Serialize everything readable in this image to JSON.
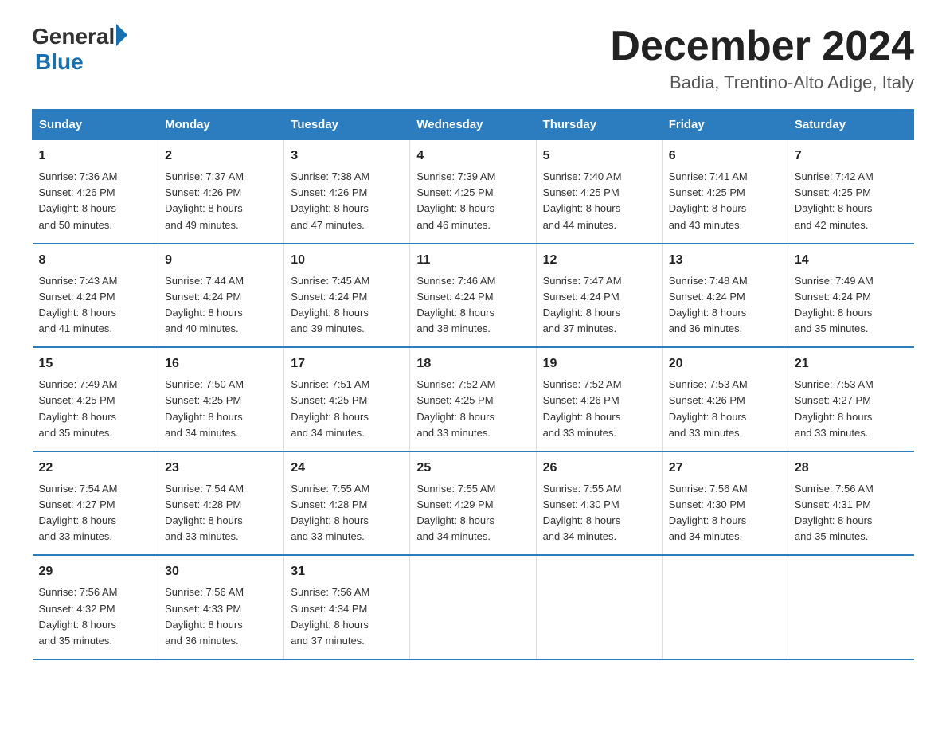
{
  "header": {
    "logo_general": "General",
    "logo_blue": "Blue",
    "month_title": "December 2024",
    "location": "Badia, Trentino-Alto Adige, Italy"
  },
  "days_of_week": [
    "Sunday",
    "Monday",
    "Tuesday",
    "Wednesday",
    "Thursday",
    "Friday",
    "Saturday"
  ],
  "weeks": [
    [
      {
        "day": "1",
        "sunrise": "7:36 AM",
        "sunset": "4:26 PM",
        "daylight": "8 hours and 50 minutes."
      },
      {
        "day": "2",
        "sunrise": "7:37 AM",
        "sunset": "4:26 PM",
        "daylight": "8 hours and 49 minutes."
      },
      {
        "day": "3",
        "sunrise": "7:38 AM",
        "sunset": "4:26 PM",
        "daylight": "8 hours and 47 minutes."
      },
      {
        "day": "4",
        "sunrise": "7:39 AM",
        "sunset": "4:25 PM",
        "daylight": "8 hours and 46 minutes."
      },
      {
        "day": "5",
        "sunrise": "7:40 AM",
        "sunset": "4:25 PM",
        "daylight": "8 hours and 44 minutes."
      },
      {
        "day": "6",
        "sunrise": "7:41 AM",
        "sunset": "4:25 PM",
        "daylight": "8 hours and 43 minutes."
      },
      {
        "day": "7",
        "sunrise": "7:42 AM",
        "sunset": "4:25 PM",
        "daylight": "8 hours and 42 minutes."
      }
    ],
    [
      {
        "day": "8",
        "sunrise": "7:43 AM",
        "sunset": "4:24 PM",
        "daylight": "8 hours and 41 minutes."
      },
      {
        "day": "9",
        "sunrise": "7:44 AM",
        "sunset": "4:24 PM",
        "daylight": "8 hours and 40 minutes."
      },
      {
        "day": "10",
        "sunrise": "7:45 AM",
        "sunset": "4:24 PM",
        "daylight": "8 hours and 39 minutes."
      },
      {
        "day": "11",
        "sunrise": "7:46 AM",
        "sunset": "4:24 PM",
        "daylight": "8 hours and 38 minutes."
      },
      {
        "day": "12",
        "sunrise": "7:47 AM",
        "sunset": "4:24 PM",
        "daylight": "8 hours and 37 minutes."
      },
      {
        "day": "13",
        "sunrise": "7:48 AM",
        "sunset": "4:24 PM",
        "daylight": "8 hours and 36 minutes."
      },
      {
        "day": "14",
        "sunrise": "7:49 AM",
        "sunset": "4:24 PM",
        "daylight": "8 hours and 35 minutes."
      }
    ],
    [
      {
        "day": "15",
        "sunrise": "7:49 AM",
        "sunset": "4:25 PM",
        "daylight": "8 hours and 35 minutes."
      },
      {
        "day": "16",
        "sunrise": "7:50 AM",
        "sunset": "4:25 PM",
        "daylight": "8 hours and 34 minutes."
      },
      {
        "day": "17",
        "sunrise": "7:51 AM",
        "sunset": "4:25 PM",
        "daylight": "8 hours and 34 minutes."
      },
      {
        "day": "18",
        "sunrise": "7:52 AM",
        "sunset": "4:25 PM",
        "daylight": "8 hours and 33 minutes."
      },
      {
        "day": "19",
        "sunrise": "7:52 AM",
        "sunset": "4:26 PM",
        "daylight": "8 hours and 33 minutes."
      },
      {
        "day": "20",
        "sunrise": "7:53 AM",
        "sunset": "4:26 PM",
        "daylight": "8 hours and 33 minutes."
      },
      {
        "day": "21",
        "sunrise": "7:53 AM",
        "sunset": "4:27 PM",
        "daylight": "8 hours and 33 minutes."
      }
    ],
    [
      {
        "day": "22",
        "sunrise": "7:54 AM",
        "sunset": "4:27 PM",
        "daylight": "8 hours and 33 minutes."
      },
      {
        "day": "23",
        "sunrise": "7:54 AM",
        "sunset": "4:28 PM",
        "daylight": "8 hours and 33 minutes."
      },
      {
        "day": "24",
        "sunrise": "7:55 AM",
        "sunset": "4:28 PM",
        "daylight": "8 hours and 33 minutes."
      },
      {
        "day": "25",
        "sunrise": "7:55 AM",
        "sunset": "4:29 PM",
        "daylight": "8 hours and 34 minutes."
      },
      {
        "day": "26",
        "sunrise": "7:55 AM",
        "sunset": "4:30 PM",
        "daylight": "8 hours and 34 minutes."
      },
      {
        "day": "27",
        "sunrise": "7:56 AM",
        "sunset": "4:30 PM",
        "daylight": "8 hours and 34 minutes."
      },
      {
        "day": "28",
        "sunrise": "7:56 AM",
        "sunset": "4:31 PM",
        "daylight": "8 hours and 35 minutes."
      }
    ],
    [
      {
        "day": "29",
        "sunrise": "7:56 AM",
        "sunset": "4:32 PM",
        "daylight": "8 hours and 35 minutes."
      },
      {
        "day": "30",
        "sunrise": "7:56 AM",
        "sunset": "4:33 PM",
        "daylight": "8 hours and 36 minutes."
      },
      {
        "day": "31",
        "sunrise": "7:56 AM",
        "sunset": "4:34 PM",
        "daylight": "8 hours and 37 minutes."
      },
      null,
      null,
      null,
      null
    ]
  ],
  "labels": {
    "sunrise": "Sunrise:",
    "sunset": "Sunset:",
    "daylight": "Daylight:"
  }
}
